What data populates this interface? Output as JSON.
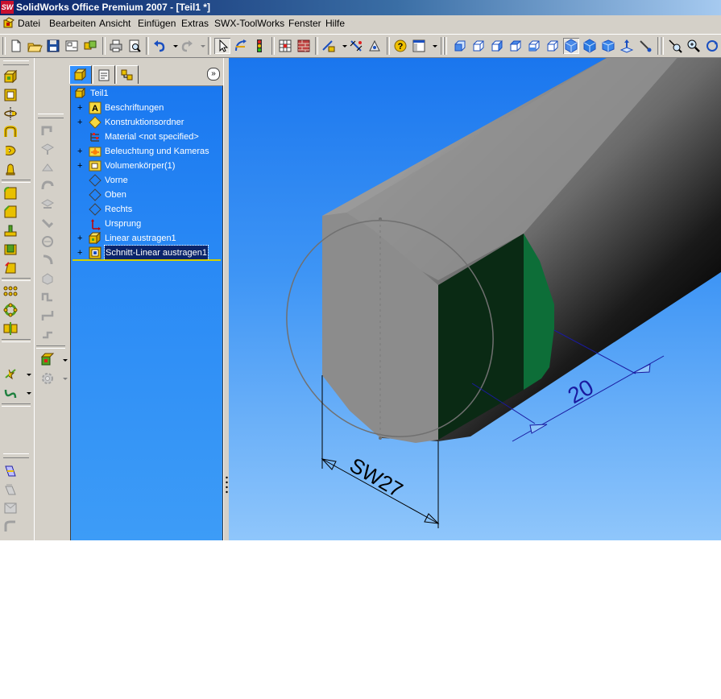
{
  "window": {
    "title": "SolidWorks Office Premium 2007 - [Teil1 *]",
    "logo": "SW"
  },
  "menu": [
    "Datei",
    "Bearbeiten",
    "Ansicht",
    "Einfügen",
    "Extras",
    "SWX-ToolWorks",
    "Fenster",
    "Hilfe"
  ],
  "feature_manager": {
    "expand_symbol": "»",
    "root": "Teil1",
    "items": [
      {
        "label": "Beschriftungen",
        "expandable": true,
        "icon": "annotations-icon"
      },
      {
        "label": "Konstruktionsordner",
        "expandable": true,
        "icon": "design-folder-icon"
      },
      {
        "label": "Material <not specified>",
        "expandable": false,
        "icon": "material-icon"
      },
      {
        "label": "Beleuchtung und Kameras",
        "expandable": true,
        "icon": "lights-cameras-icon"
      },
      {
        "label": "Volumenkörper(1)",
        "expandable": true,
        "icon": "solid-bodies-icon"
      },
      {
        "label": "Vorne",
        "expandable": false,
        "icon": "plane-icon"
      },
      {
        "label": "Oben",
        "expandable": false,
        "icon": "plane-icon"
      },
      {
        "label": "Rechts",
        "expandable": false,
        "icon": "plane-icon"
      },
      {
        "label": "Ursprung",
        "expandable": false,
        "icon": "origin-icon"
      },
      {
        "label": "Linear austragen1",
        "expandable": true,
        "icon": "extrude-icon"
      },
      {
        "label": "Schnitt-Linear austragen1",
        "expandable": true,
        "icon": "cut-extrude-icon",
        "selected": true
      }
    ]
  },
  "viewport": {
    "dimension_width_across_flats": "SW27",
    "dimension_depth": "20",
    "colors": {
      "cylinder_light": "#9a9a9a",
      "flat_face": "#0d3a1f",
      "flat_face_light": "#0e6a35",
      "dimension": "#1a1aa0",
      "end_face": "#8c8c8c"
    }
  },
  "colors": {
    "tree_background": "#1a78f0",
    "title_bar": "#0a246a",
    "chrome": "#d4d0c8"
  }
}
